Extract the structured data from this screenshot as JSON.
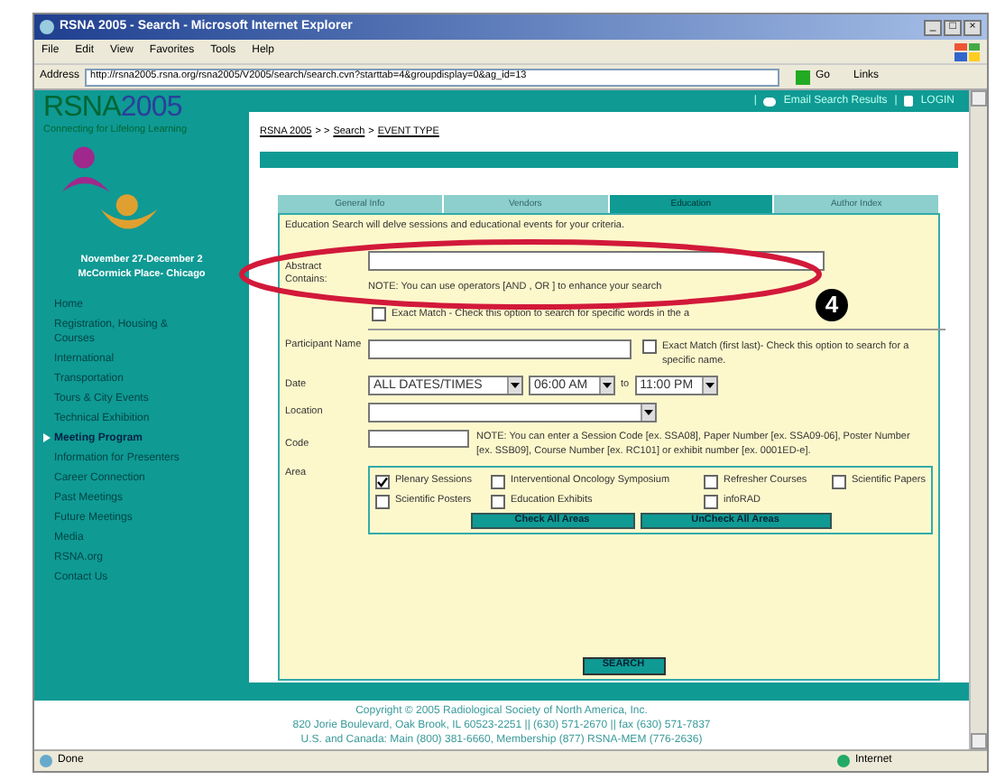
{
  "window": {
    "title": "RSNA 2005 - Search - Microsoft Internet Explorer",
    "controls": [
      "_",
      "□",
      "×"
    ]
  },
  "menu": [
    "File",
    "Edit",
    "View",
    "Favorites",
    "Tools",
    "Help"
  ],
  "address_bar": {
    "label": "Address",
    "url": "http://rsna2005.rsna.org/rsna2005/V2005/search/search.cvn?starttab=4&groupdisplay=0&ag_id=13",
    "go": "Go",
    "links": "Links"
  },
  "sidebar": {
    "logo": {
      "part_1": "RSNA",
      "part_2": "2005"
    },
    "tagline": "Connecting for Lifelong Learning",
    "dates": [
      "November 27-December 2",
      "McCormick Place- Chicago"
    ],
    "items": [
      {
        "label": "Home",
        "selected": false
      },
      {
        "label": "Registration, Housing & Courses",
        "selected": false
      },
      {
        "label": "International",
        "selected": false
      },
      {
        "label": "Transportation",
        "selected": false
      },
      {
        "label": "Tours & City Events",
        "selected": false
      },
      {
        "label": "Technical Exhibition",
        "selected": false
      },
      {
        "label": "Meeting Program",
        "selected": true
      },
      {
        "label": "Information for Presenters",
        "selected": false
      },
      {
        "label": "Career Connection",
        "selected": false
      },
      {
        "label": "Past Meetings",
        "selected": false
      },
      {
        "label": "Future Meetings",
        "selected": false
      },
      {
        "label": "Media",
        "selected": false
      },
      {
        "label": "RSNA.org",
        "selected": false
      },
      {
        "label": "Contact Us",
        "selected": false
      }
    ]
  },
  "top_bar": {
    "separator": "|",
    "email": "Email Search Results",
    "login": "LOGIN"
  },
  "breadcrumb": [
    "RSNA 2005",
    ">  >",
    "Search",
    ">",
    "EVENT TYPE"
  ],
  "tabs": [
    {
      "label": "General Info",
      "selected": false
    },
    {
      "label": "Vendors",
      "selected": false
    },
    {
      "label": "Education",
      "selected": true
    },
    {
      "label": "Author Index",
      "selected": false
    }
  ],
  "form": {
    "intro": "Education Search will delve sessions and educational events for your criteria.",
    "abstract": {
      "label": "Abstract Contains:",
      "note": "NOTE: You can use operators [AND , OR ] to enhance your search",
      "exact_match": {
        "checked": false,
        "label": "Exact Match - Check this option to search for specific words in the a"
      }
    },
    "participant": {
      "label": "Participant Name",
      "exact_match": {
        "checked": false,
        "label": "Exact Match (first last)- Check this option to search for a specific name."
      }
    },
    "date": {
      "label": "Date",
      "dates": "ALL DATES/TIMES",
      "from": "06:00 AM",
      "to_label": "to",
      "to": "11:00 PM"
    },
    "location": {
      "label": "Location"
    },
    "code": {
      "label": "Code",
      "note": "NOTE: You can enter a Session Code [ex. SSA08], Paper Number [ex. SSA09-06], Poster Number [ex. SSB09], Course Number [ex. RC101] or exhibit number [ex. 0001ED-e]."
    },
    "area": {
      "label": "Area",
      "options": [
        {
          "label": "Plenary Sessions",
          "checked": true
        },
        {
          "label": "Interventional Oncology Symposium",
          "checked": false
        },
        {
          "label": "Refresher Courses",
          "checked": false
        },
        {
          "label": "Scientific Papers",
          "checked": false
        },
        {
          "label": "Scientific Posters",
          "checked": false
        },
        {
          "label": "Education Exhibits",
          "checked": false
        },
        {
          "label": "infoRAD",
          "checked": false
        }
      ],
      "check_all": "Check All Areas",
      "uncheck_all": "UnCheck All Areas"
    },
    "search": "SEARCH"
  },
  "footer": [
    "Copyright © 2005 Radiological Society of North America, Inc.",
    "820 Jorie Boulevard, Oak Brook, IL 60523-2251 || (630) 571-2670 || fax (630) 571-7837",
    "U.S. and Canada: Main (800) 381-6660, Membership (877) RSNA-MEM (776-2636)"
  ],
  "status_bar": {
    "text": "Done",
    "zone": "Internet"
  },
  "callout": "4"
}
